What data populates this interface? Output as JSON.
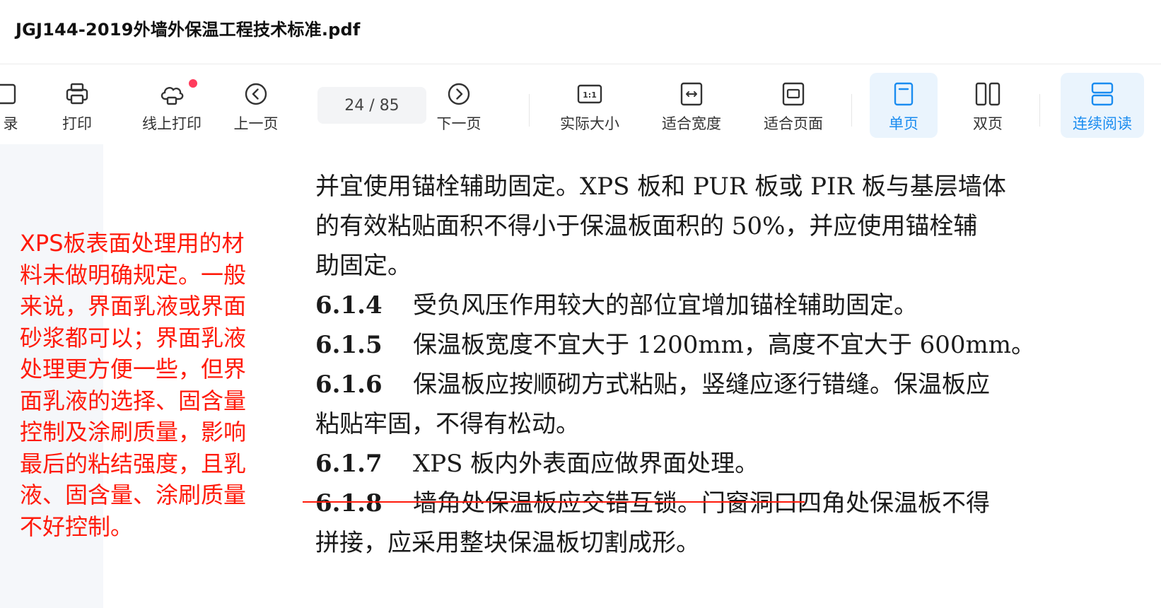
{
  "window": {
    "title": "JGJ144-2019外墙外保温工程技术标准.pdf"
  },
  "toolbar": {
    "catalog_label": "录",
    "print_label": "打印",
    "online_print_label": "线上打印",
    "prev_label": "上一页",
    "page_indicator": "24 / 85",
    "next_label": "下一页",
    "actual_size_label": "实际大小",
    "fit_width_label": "适合宽度",
    "fit_page_label": "适合页面",
    "single_page_label": "单页",
    "double_page_label": "双页",
    "continuous_label": "连续阅读",
    "accent_color": "#1a8cf0",
    "notification_color": "#ff3b5c"
  },
  "annotation": {
    "lines": [
      "XPS板表面处理用的材",
      "料未做明确规定。一般",
      "来说，界面乳液或界面",
      "砂浆都可以；界面乳液",
      "处理更方便一些，但界",
      "面乳液的选择、固含量",
      "控制及涂刷质量，影响",
      "最后的粘结强度，且乳",
      "液、固含量、涂刷质量",
      "不好控制。"
    ],
    "color": "#ff1a0a"
  },
  "document": {
    "lines": [
      {
        "num": "",
        "text": "并宜使用锚栓辅助固定。XPS 板和 PUR 板或 PIR 板与基层墙体"
      },
      {
        "num": "",
        "text": "的有效粘贴面积不得小于保温板面积的 50%，并应使用锚栓辅"
      },
      {
        "num": "",
        "text": "助固定。"
      },
      {
        "num": "6.1.4",
        "text": "受负风压作用较大的部位宜增加锚栓辅助固定。"
      },
      {
        "num": "6.1.5",
        "text": "保温板宽度不宜大于 1200mm，高度不宜大于 600mm。"
      },
      {
        "num": "6.1.6",
        "text": "保温板应按顺砌方式粘贴，竖缝应逐行错缝。保温板应"
      },
      {
        "num": "",
        "text": "粘贴牢固，不得有松动。"
      },
      {
        "num": "6.1.7",
        "text": "XPS 板内外表面应做界面处理。"
      },
      {
        "num": "6.1.8",
        "text": "墙角处保温板应交错互锁。门窗洞口四角处保温板不得"
      },
      {
        "num": "",
        "text": "拼接，应采用整块保温板切割成形。"
      }
    ]
  }
}
